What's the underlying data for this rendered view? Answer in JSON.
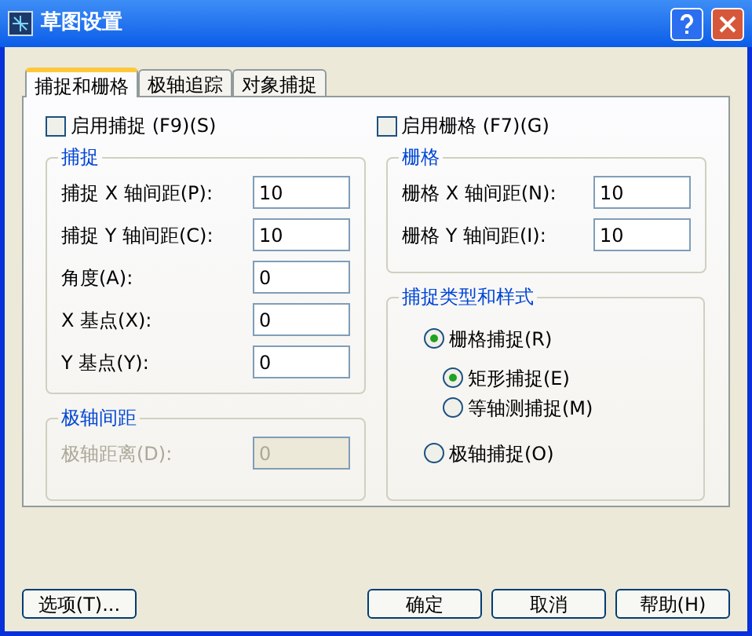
{
  "window": {
    "title": "草图设置"
  },
  "tabs": [
    {
      "label": "捕捉和栅格",
      "selected": true
    },
    {
      "label": "极轴追踪",
      "selected": false
    },
    {
      "label": "对象捕捉",
      "selected": false
    }
  ],
  "checkboxes": [
    {
      "label": "启用捕捉 (F9)(S)",
      "checked": false
    },
    {
      "label": "启用栅格 (F7)(G)",
      "checked": false
    }
  ],
  "snap_group": {
    "title": "捕捉",
    "fields": [
      {
        "label": "捕捉 X 轴间距(P):",
        "value": "10",
        "disabled": false
      },
      {
        "label": "捕捉 Y 轴间距(C):",
        "value": "10",
        "disabled": false
      },
      {
        "label": "角度(A):",
        "value": "0",
        "disabled": false
      },
      {
        "label": "X 基点(X):",
        "value": "0",
        "disabled": false
      },
      {
        "label": "Y 基点(Y):",
        "value": "0",
        "disabled": false
      }
    ]
  },
  "polar_group": {
    "title": "极轴间距",
    "fields": [
      {
        "label": "极轴距离(D):",
        "value": "0",
        "disabled": true
      }
    ]
  },
  "grid_group": {
    "title": "栅格",
    "fields": [
      {
        "label": "栅格 X 轴间距(N):",
        "value": "10",
        "disabled": false
      },
      {
        "label": "栅格 Y 轴间距(I):",
        "value": "10",
        "disabled": false
      }
    ]
  },
  "snap_type_group": {
    "title": "捕捉类型和样式",
    "options": [
      {
        "label": "栅格捕捉(R)",
        "selected": true,
        "children": [
          {
            "label": "矩形捕捉(E)",
            "selected": true
          },
          {
            "label": "等轴测捕捉(M)",
            "selected": false
          }
        ]
      },
      {
        "label": "极轴捕捉(O)",
        "selected": false
      }
    ]
  },
  "buttons_left": [
    "选项(T)..."
  ],
  "buttons": [
    "确定",
    "取消",
    "帮助(H)"
  ]
}
